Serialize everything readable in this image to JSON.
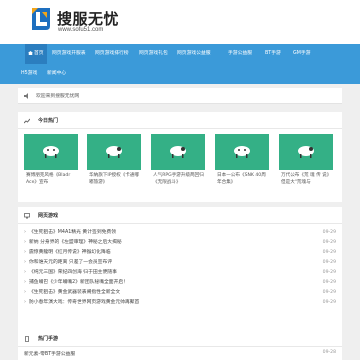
{
  "brand": {
    "title": "搜服无忧",
    "url": "www.sofu51.com"
  },
  "nav": [
    {
      "label": "首页",
      "active": true
    },
    {
      "label": "网页游戏开服表"
    },
    {
      "label": "网页游戏排行榜"
    },
    {
      "label": "网页游戏礼包"
    },
    {
      "label": "网页游戏公益服"
    },
    {
      "label": "手游公益服"
    },
    {
      "label": "BT手游"
    },
    {
      "label": "GM手游"
    },
    {
      "label": "H5游戏"
    },
    {
      "label": "新闻中心"
    }
  ],
  "notice": "欢迎来到搜服无忧网",
  "hot": {
    "title": "今日热门",
    "cards": [
      {
        "caption": "赛博朋克风格《Bladr Ace》宣布"
      },
      {
        "caption": "华納旗下IP授权《卡通嘟嘟旅游》"
      },
      {
        "caption": "人气RPG手游升级两回归《无限战斗》"
      },
      {
        "caption": "日本一公布《SNK 40周年合集》"
      },
      {
        "caption": "万代公布《荒 魂 传 说》 但是大\"荒魂与"
      }
    ]
  },
  "games": {
    "title": "网页游戏",
    "items": [
      {
        "title": "《生死狙击》M4A1精光 黄计签到免费领",
        "date": "09-29"
      },
      {
        "title": "新纳 分身界的《左盟审理》神秘之后大揭秘",
        "date": "09-29"
      },
      {
        "title": "震惊黄龍明《红月传说》神猴幻化降临",
        "date": "09-29"
      },
      {
        "title": "你和谁天元的距离 只差了一会员宣布评",
        "date": "09-29"
      },
      {
        "title": "《纯元三国》荣纪四创海 归于田主便随事",
        "date": "09-29"
      },
      {
        "title": "捕鱼嘴巴《少年嘴嘴2》新团队秘嘴全面开启！",
        "date": "09-29"
      },
      {
        "title": "《生死狙击》黄金武器装表阐指性全新全文",
        "date": "09-29"
      },
      {
        "title": "防小春年演大戏：传奇世界网页游戏黄金元帅再聚首",
        "date": "09-29"
      }
    ]
  },
  "mobile": {
    "title": "热门手游",
    "first": {
      "title": "新元素-零BT手游公益服",
      "date": "09-28"
    }
  },
  "colors": {
    "nav": "#3b9ad9",
    "nav_active": "#2b7ebf",
    "card": "#34b086"
  }
}
